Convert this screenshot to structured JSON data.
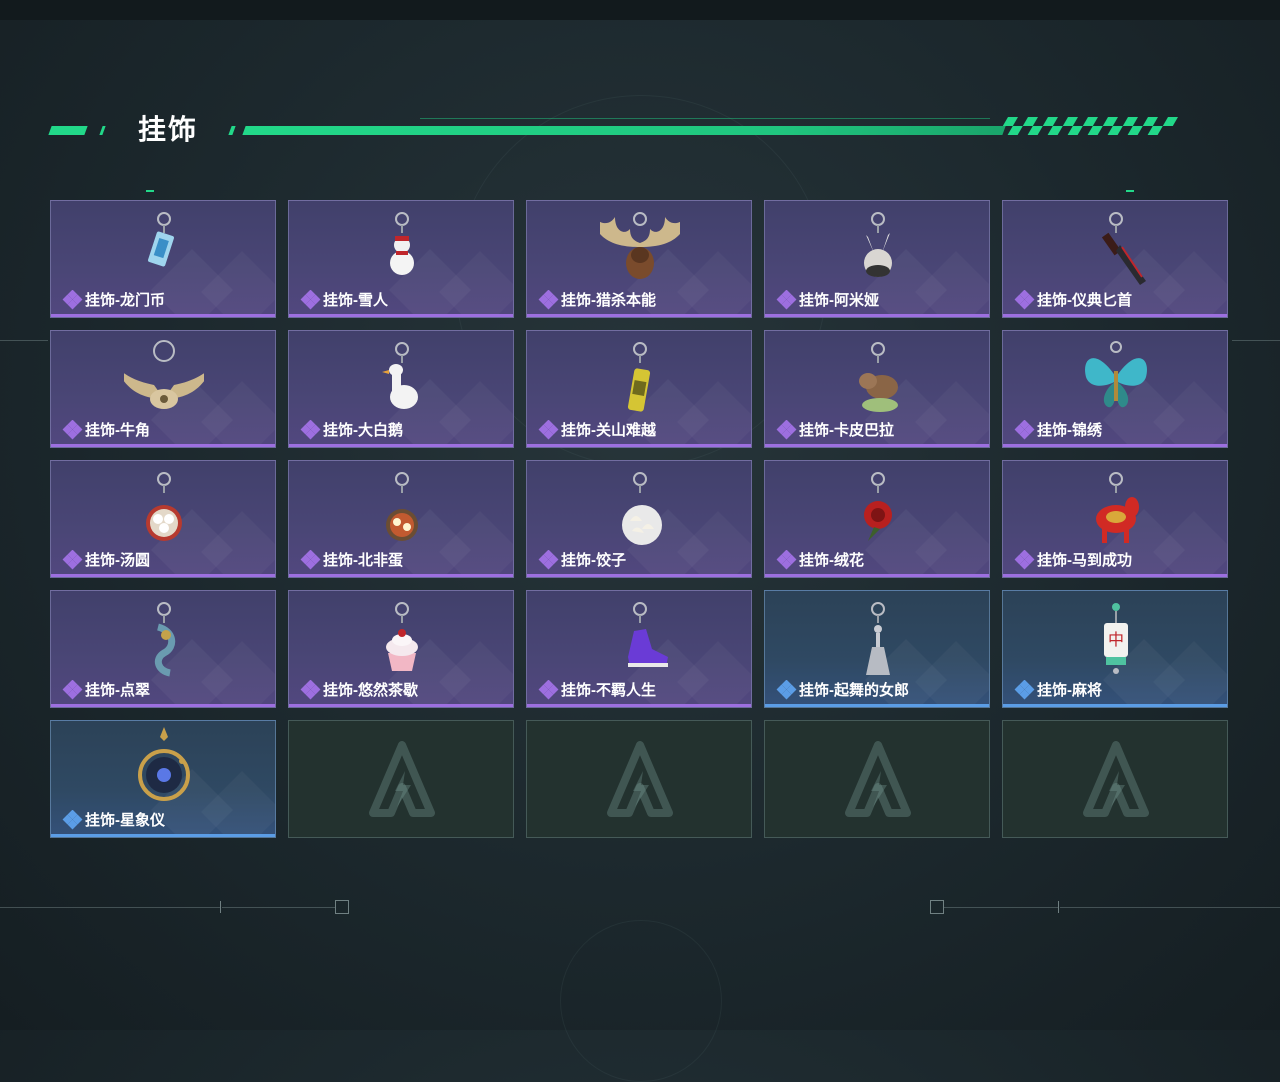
{
  "section": {
    "title": "挂饰"
  },
  "items": [
    {
      "label": "挂饰-龙门币",
      "rarity": "purple",
      "icon": "longmen-coin-charm-icon"
    },
    {
      "label": "挂饰-雪人",
      "rarity": "purple",
      "icon": "snowman-charm-icon"
    },
    {
      "label": "挂饰-猎杀本能",
      "rarity": "purple",
      "icon": "antler-trophy-charm-icon"
    },
    {
      "label": "挂饰-阿米娅",
      "rarity": "purple",
      "icon": "amiya-charm-icon"
    },
    {
      "label": "挂饰-仪典匕首",
      "rarity": "purple",
      "icon": "ceremonial-dagger-charm-icon"
    },
    {
      "label": "挂饰-牛角",
      "rarity": "purple",
      "icon": "bull-horns-charm-icon"
    },
    {
      "label": "挂饰-大白鹅",
      "rarity": "purple",
      "icon": "white-goose-charm-icon"
    },
    {
      "label": "挂饰-关山难越",
      "rarity": "purple",
      "icon": "yellow-can-charm-icon"
    },
    {
      "label": "挂饰-卡皮巴拉",
      "rarity": "purple",
      "icon": "capybara-charm-icon"
    },
    {
      "label": "挂饰-锦绣",
      "rarity": "purple",
      "icon": "butterfly-charm-icon"
    },
    {
      "label": "挂饰-汤圆",
      "rarity": "purple",
      "icon": "tangyuan-bowl-charm-icon"
    },
    {
      "label": "挂饰-北非蛋",
      "rarity": "purple",
      "icon": "shakshuka-charm-icon"
    },
    {
      "label": "挂饰-饺子",
      "rarity": "purple",
      "icon": "dumplings-plate-charm-icon"
    },
    {
      "label": "挂饰-绒花",
      "rarity": "purple",
      "icon": "velvet-flower-charm-icon"
    },
    {
      "label": "挂饰-马到成功",
      "rarity": "purple",
      "icon": "red-horse-charm-icon"
    },
    {
      "label": "挂饰-点翠",
      "rarity": "purple",
      "icon": "kingfisher-ornament-charm-icon"
    },
    {
      "label": "挂饰-悠然茶歇",
      "rarity": "purple",
      "icon": "cupcake-charm-icon"
    },
    {
      "label": "挂饰-不羁人生",
      "rarity": "purple",
      "icon": "sneaker-charm-icon"
    },
    {
      "label": "挂饰-起舞的女郎",
      "rarity": "blue",
      "icon": "dancing-lady-charm-icon"
    },
    {
      "label": "挂饰-麻将",
      "rarity": "blue",
      "icon": "mahjong-tile-charm-icon"
    },
    {
      "label": "挂饰-星象仪",
      "rarity": "blue",
      "icon": "astrolabe-charm-icon"
    }
  ],
  "empty_slots": 4,
  "colors": {
    "accent": "#22d889",
    "purple_rarity": "#9d6fe0",
    "blue_rarity": "#5b9de6"
  }
}
